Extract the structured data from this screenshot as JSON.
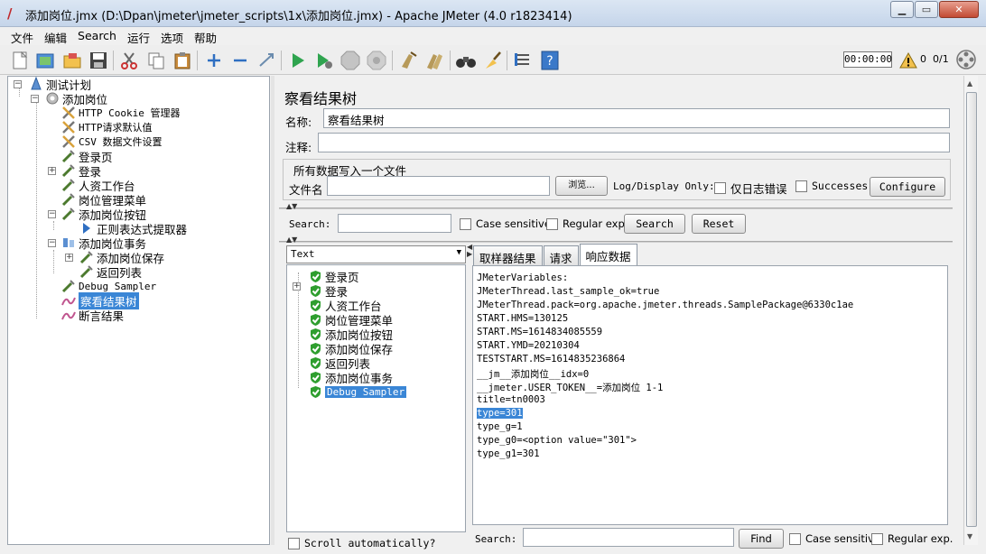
{
  "window": {
    "title": "添加岗位.jmx (D:\\Dpan\\jmeter\\jmeter_scripts\\1x\\添加岗位.jmx) - Apache JMeter (4.0 r1823414)",
    "minimize": "▁",
    "maximize": "▭",
    "close": "✕"
  },
  "menu": [
    "文件",
    "编辑",
    "Search",
    "运行",
    "选项",
    "帮助"
  ],
  "toolbar": {
    "timer": "00:00:00",
    "warnings": "0",
    "threads": "0/1"
  },
  "tree": {
    "root": "测试计划",
    "thread_group": "添加岗位",
    "items": [
      {
        "label": "HTTP Cookie 管理器",
        "mono": true
      },
      {
        "label": "HTTP请求默认值",
        "mono": true
      },
      {
        "label": "CSV 数据文件设置",
        "mono": true
      },
      {
        "label": "登录页"
      },
      {
        "label": "登录"
      },
      {
        "label": "人资工作台"
      },
      {
        "label": "岗位管理菜单"
      },
      {
        "label": "添加岗位按钮"
      },
      {
        "label": "正则表达式提取器"
      },
      {
        "label": "添加岗位事务"
      },
      {
        "label": "添加岗位保存"
      },
      {
        "label": "返回列表"
      },
      {
        "label": "Debug Sampler",
        "mono": true
      },
      {
        "label": "察看结果树"
      },
      {
        "label": "断言结果"
      }
    ]
  },
  "panel": {
    "title": "察看结果树",
    "name_label": "名称:",
    "name_value": "察看结果树",
    "comment_label": "注释:",
    "comment_value": "",
    "file_group_title": "所有数据写入一个文件",
    "filename_label": "文件名",
    "filename_value": "",
    "browse_button": "浏览...",
    "log_display_label": "Log/Display Only:",
    "errors_only_label": "仅日志错误",
    "successes_label": "Successes",
    "configure_button": "Configure"
  },
  "search": {
    "label": "Search:",
    "value": "",
    "case_sensitive": "Case sensitive",
    "regular_exp": "Regular exp.",
    "search_button": "Search",
    "reset_button": "Reset"
  },
  "results": {
    "renderer": "Text",
    "samples": [
      "登录页",
      "登录",
      "人资工作台",
      "岗位管理菜单",
      "添加岗位按钮",
      "添加岗位保存",
      "返回列表",
      "添加岗位事务",
      "Debug Sampler"
    ],
    "scroll_auto": "Scroll automatically?",
    "tabs": [
      "取样器结果",
      "请求",
      "响应数据"
    ],
    "active_tab": "响应数据",
    "response_lines": [
      "JMeterVariables:",
      "JMeterThread.last_sample_ok=true",
      "JMeterThread.pack=org.apache.jmeter.threads.SamplePackage@6330c1ae",
      "START.HMS=130125",
      "START.MS=1614834085559",
      "START.YMD=20210304",
      "TESTSTART.MS=1614835236864",
      "__jm__添加岗位__idx=0",
      "__jmeter.USER_TOKEN__=添加岗位 1-1",
      "title=tn0003",
      "type=301",
      "type_g=1",
      "type_g0=<option value=\"301\">",
      "type_g1=301"
    ],
    "find_label": "Search:",
    "find_value": "",
    "find_button": "Find",
    "find_case": "Case sensitive",
    "find_regex": "Regular exp."
  },
  "colors": {
    "selection": "#3a86d6",
    "check_green": "#2e9e2e"
  }
}
